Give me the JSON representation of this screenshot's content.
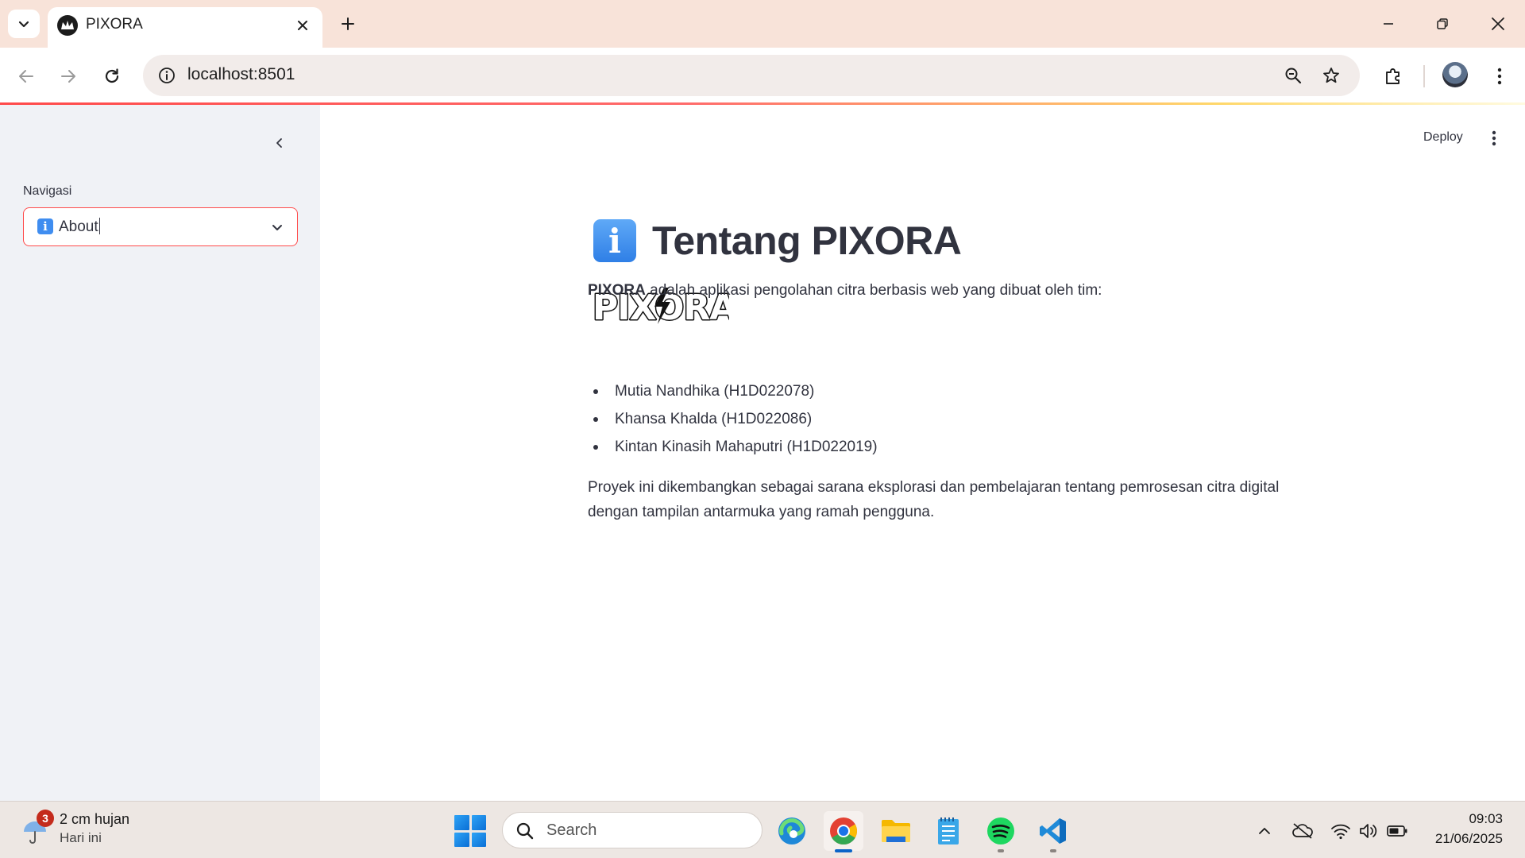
{
  "browser": {
    "tab_title": "PIXORA",
    "url": "localhost:8501"
  },
  "sidebar": {
    "nav_label": "Navigasi",
    "select_value": "About"
  },
  "header": {
    "deploy_label": "Deploy"
  },
  "content": {
    "title": "Tentang PIXORA",
    "logo_text": "PIXORA",
    "intro_bold": "PIXORA",
    "intro_rest": " adalah aplikasi pengolahan citra berbasis web yang dibuat oleh tim:",
    "team": [
      "Mutia Nandhika (H1D022078)",
      "Khansa Khalda (H1D022086)",
      "Kintan Kinasih Mahaputri (H1D022019)"
    ],
    "closing_line1": "Proyek ini dikembangkan sebagai sarana eksplorasi dan pembelajaran tentang pemrosesan citra digital",
    "closing_line2": "dengan tampilan antarmuka yang ramah pengguna."
  },
  "taskbar": {
    "weather_badge": "3",
    "weather_main": "2 cm hujan",
    "weather_sub": "Hari ini",
    "search_placeholder": "Search",
    "time": "09:03",
    "date": "21/06/2025"
  },
  "colors": {
    "accent": "#ff4b4b",
    "sidebar_bg": "#f0f2f6",
    "text": "#31333f",
    "tab_strip": "#f8e3d9"
  }
}
